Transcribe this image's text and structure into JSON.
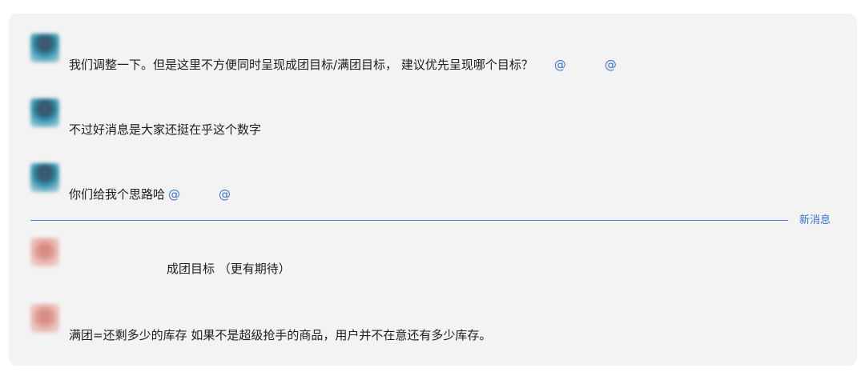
{
  "messages": [
    {
      "sender": "",
      "time": "",
      "text": "我们调整一下。但是这里不方便同时呈现成团目标/满团目标， 建议优先呈现哪个目标？",
      "mentions": [
        "@",
        "@"
      ]
    },
    {
      "sender": "",
      "time": "",
      "text": "不过好消息是大家还挺在乎这个数字",
      "mentions": []
    },
    {
      "sender": "",
      "time": "",
      "text": "你们给我个思路哈",
      "mentions": [
        "@",
        "@"
      ]
    },
    {
      "sender": "",
      "time": "",
      "text": "成团目标 （更有期待）",
      "mentions": []
    },
    {
      "sender": "",
      "time": "",
      "text": "满团=还剩多少的库存  如果不是超级抢手的商品，用户并不在意还有多少库存。",
      "mentions": []
    }
  ],
  "divider": {
    "label": "新消息"
  },
  "colors": {
    "link": "#3b72d6",
    "divider": "#4a7fe0",
    "panel": "#f3f3f3"
  }
}
